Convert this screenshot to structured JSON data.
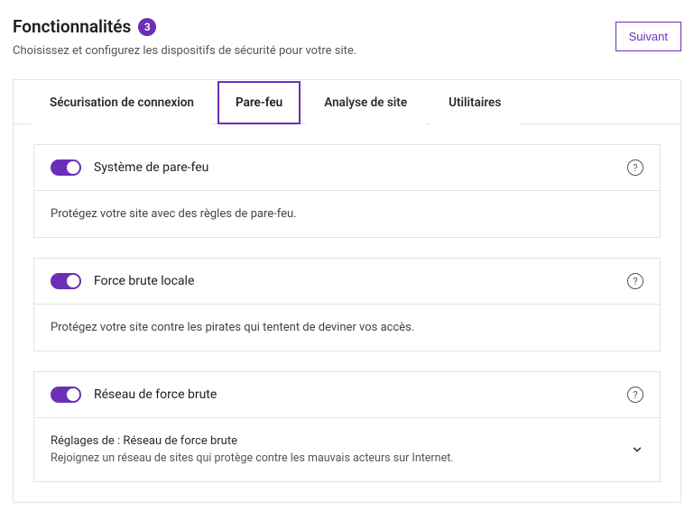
{
  "header": {
    "title": "Fonctionnalités",
    "badge": "3",
    "subtitle": "Choisissez et configurez les dispositifs de sécurité pour votre site.",
    "next_button": "Suivant"
  },
  "tabs": {
    "login_security": "Sécurisation de connexion",
    "firewall": "Pare-feu",
    "site_scan": "Analyse de site",
    "utilities": "Utilitaires"
  },
  "cards": {
    "firewall_system": {
      "title": "Système de pare-feu",
      "description": "Protégez votre site avec des règles de pare-feu."
    },
    "local_brute": {
      "title": "Force brute locale",
      "description": "Protégez votre site contre les pirates qui tentent de deviner vos accès."
    },
    "network_brute": {
      "title": "Réseau de force brute",
      "settings_label": "Réglages de : Réseau de force brute",
      "description": "Rejoignez un réseau de sites qui protège contre les mauvais acteurs sur Internet."
    }
  },
  "help_glyph": "?"
}
